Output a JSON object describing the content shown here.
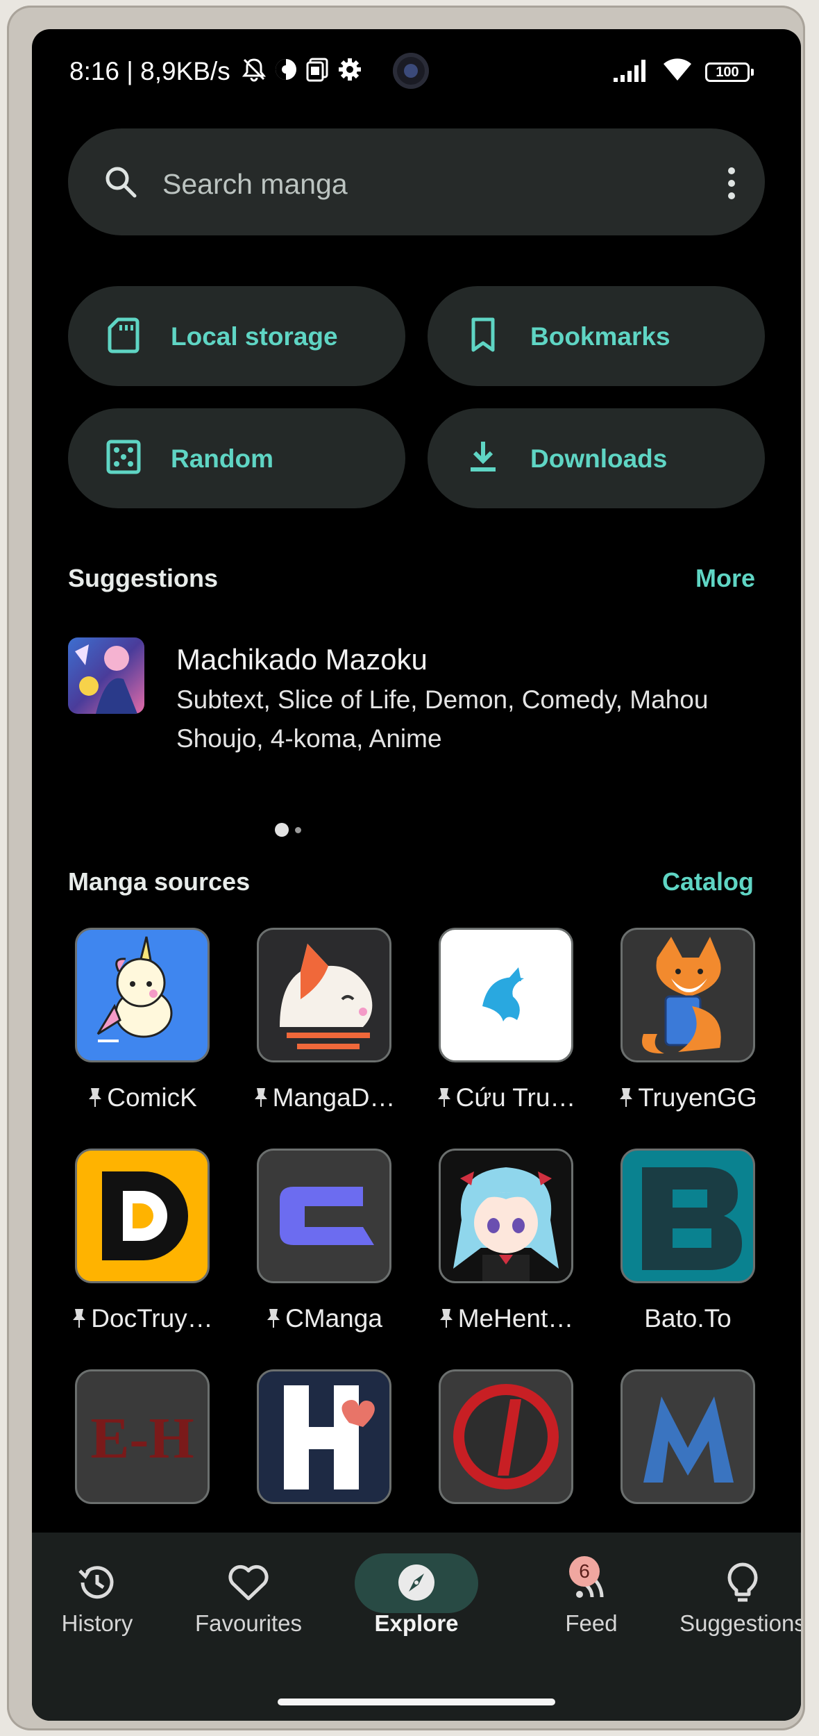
{
  "status_bar": {
    "time": "8:16 | 8,9KB/s",
    "battery": "100"
  },
  "search": {
    "placeholder": "Search manga"
  },
  "quick_actions": [
    {
      "label": "Local storage",
      "icon": "sd-card-icon"
    },
    {
      "label": "Bookmarks",
      "icon": "bookmark-icon"
    },
    {
      "label": "Random",
      "icon": "dice-icon"
    },
    {
      "label": "Downloads",
      "icon": "download-icon"
    }
  ],
  "suggestions": {
    "title": "Suggestions",
    "more_label": "More",
    "item": {
      "title": "Machikado Mazoku",
      "tags": "Subtext, Slice of  Life, Demon, Comedy, Mahou Shoujo, 4-koma, Anime"
    },
    "page_count": 2,
    "current_page": 1
  },
  "manga_sources": {
    "title": "Manga sources",
    "catalog_label": "Catalog",
    "items": [
      {
        "label": "ComicK",
        "pinned": true
      },
      {
        "label": "MangaD…",
        "pinned": true
      },
      {
        "label": "Cứu Tru…",
        "pinned": true
      },
      {
        "label": "TruyenGG",
        "pinned": true
      },
      {
        "label": "DocTruy…",
        "pinned": true
      },
      {
        "label": "CManga",
        "pinned": true
      },
      {
        "label": "MeHent…",
        "pinned": true
      },
      {
        "label": "Bato.To",
        "pinned": false
      },
      {
        "label": "",
        "pinned": false
      },
      {
        "label": "",
        "pinned": false
      },
      {
        "label": "",
        "pinned": false
      },
      {
        "label": "",
        "pinned": false
      }
    ]
  },
  "bottom_nav": {
    "items": [
      {
        "label": "History",
        "icon": "history-icon"
      },
      {
        "label": "Favourites",
        "icon": "heart-icon"
      },
      {
        "label": "Explore",
        "icon": "compass-icon",
        "active": true
      },
      {
        "label": "Feed",
        "icon": "rss-icon",
        "badge": "6"
      },
      {
        "label": "Suggestions",
        "icon": "lightbulb-icon"
      }
    ]
  },
  "colors": {
    "accent": "#5fd5c4",
    "background": "#000000",
    "surface": "#242928",
    "nav_background": "#1b1f1e",
    "badge": "#f0a7a0"
  }
}
